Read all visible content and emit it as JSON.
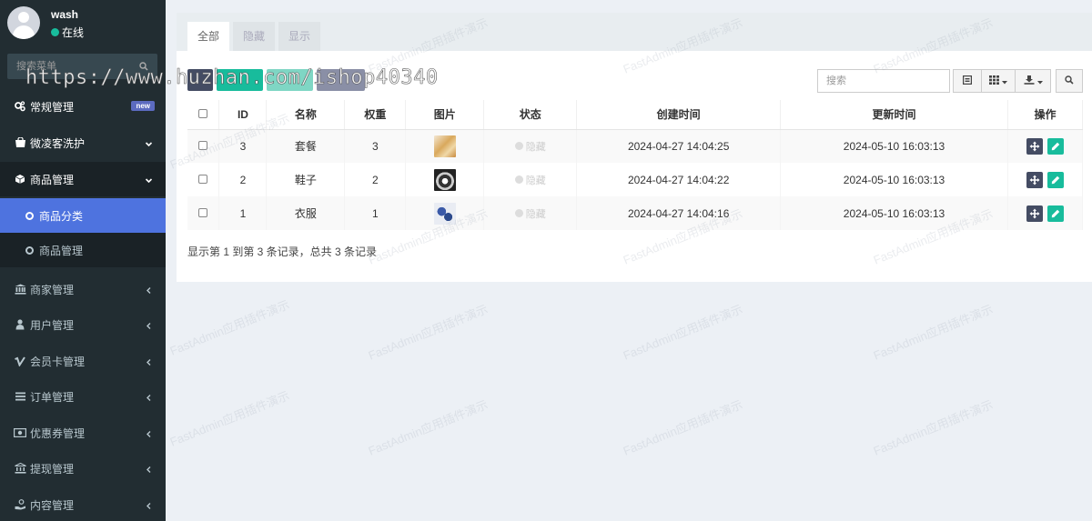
{
  "user": {
    "name": "wash",
    "status": "在线"
  },
  "sidebar": {
    "search_placeholder": "搜索菜单",
    "items": [
      {
        "label": "常规管理",
        "badge": "new"
      },
      {
        "label": "微凌客洗护"
      },
      {
        "label": "商品管理"
      },
      {
        "label": "商品分类"
      },
      {
        "label": "商品管理"
      },
      {
        "label": "商家管理"
      },
      {
        "label": "用户管理"
      },
      {
        "label": "会员卡管理"
      },
      {
        "label": "订单管理"
      },
      {
        "label": "优惠券管理"
      },
      {
        "label": "提现管理"
      },
      {
        "label": "内容管理"
      }
    ]
  },
  "tabs": [
    "全部",
    "隐藏",
    "显示"
  ],
  "search_placeholder": "搜索",
  "watermark_url": "https://www.huzhan.com/ishop40340",
  "watermark_text": "FastAdmin应用插件演示",
  "table": {
    "headers": [
      "ID",
      "名称",
      "权重",
      "图片",
      "状态",
      "创建时间",
      "更新时间",
      "操作"
    ],
    "rows": [
      {
        "id": "3",
        "name": "套餐",
        "weight": "3",
        "status": "隐藏",
        "created": "2024-04-27 14:04:25",
        "updated": "2024-05-10 16:03:13"
      },
      {
        "id": "2",
        "name": "鞋子",
        "weight": "2",
        "status": "隐藏",
        "created": "2024-04-27 14:04:22",
        "updated": "2024-05-10 16:03:13"
      },
      {
        "id": "1",
        "name": "衣服",
        "weight": "1",
        "status": "隐藏",
        "created": "2024-04-27 14:04:16",
        "updated": "2024-05-10 16:03:13"
      }
    ]
  },
  "footer": "显示第 1 到第 3 条记录，总共 3 条记录",
  "colors": {
    "sidebar": "#222d32",
    "active": "#4e73df",
    "success": "#18bc9c",
    "dark_btn": "#444c63"
  }
}
